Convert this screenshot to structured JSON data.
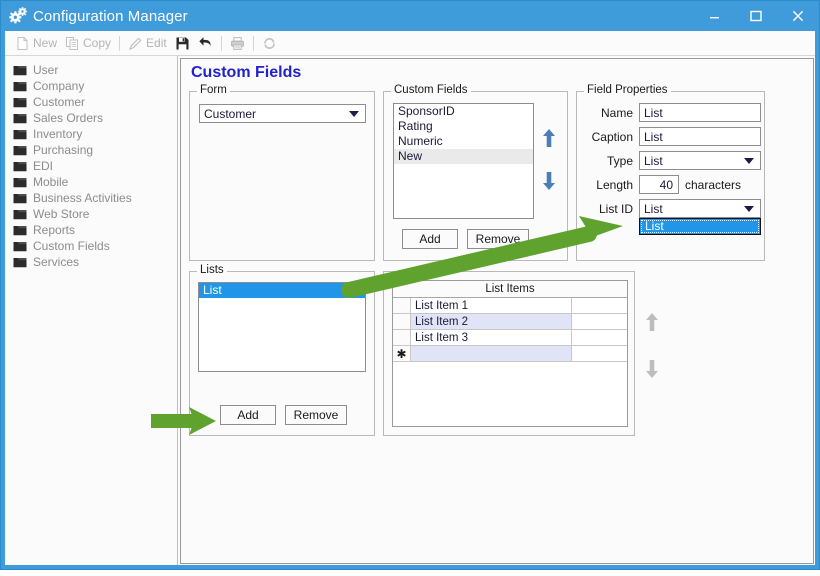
{
  "window": {
    "title": "Configuration Manager",
    "icon": "gears-icon",
    "controls": {
      "minimize": "minimize",
      "maximize": "maximize",
      "close": "close"
    },
    "accent_color": "#3f9bd9"
  },
  "toolbar": {
    "items": [
      {
        "label": "New",
        "icon": "new-document-icon",
        "enabled": false
      },
      {
        "label": "Copy",
        "icon": "copy-icon",
        "enabled": false
      },
      {
        "label": "Edit",
        "icon": "pencil-icon",
        "enabled": false
      },
      {
        "label": "",
        "icon": "save-icon",
        "enabled": true
      },
      {
        "label": "",
        "icon": "undo-icon",
        "enabled": true
      },
      {
        "label": "",
        "icon": "print-icon",
        "enabled": false
      },
      {
        "label": "",
        "icon": "refresh-icon",
        "enabled": false
      }
    ]
  },
  "sidebar": {
    "items": [
      {
        "label": "User"
      },
      {
        "label": "Company"
      },
      {
        "label": "Customer"
      },
      {
        "label": "Sales Orders"
      },
      {
        "label": "Inventory"
      },
      {
        "label": "Purchasing"
      },
      {
        "label": "EDI"
      },
      {
        "label": "Mobile"
      },
      {
        "label": "Business Activities"
      },
      {
        "label": "Web Store"
      },
      {
        "label": "Reports"
      },
      {
        "label": "Custom Fields"
      },
      {
        "label": "Services"
      }
    ]
  },
  "page": {
    "title": "Custom Fields",
    "title_color": "#2222cc"
  },
  "form_group": {
    "legend": "Form",
    "combo_value": "Customer"
  },
  "custom_fields_group": {
    "legend": "Custom Fields",
    "items": [
      {
        "label": "SponsorID",
        "selected": false
      },
      {
        "label": "Rating",
        "selected": false
      },
      {
        "label": "Numeric",
        "selected": false
      },
      {
        "label": "New",
        "selected": true
      }
    ],
    "add_label": "Add",
    "remove_label": "Remove",
    "move_up_icon": "arrow-up-icon",
    "move_down_icon": "arrow-down-icon",
    "arrow_color": "#4a7fb5"
  },
  "field_properties": {
    "legend": "Field Properties",
    "name_label": "Name",
    "name_value": "List",
    "caption_label": "Caption",
    "caption_value": "List",
    "type_label": "Type",
    "type_value": "List",
    "length_label": "Length",
    "length_value": "40",
    "length_suffix": "characters",
    "listid_label": "List ID",
    "listid_value": "List",
    "listid_options": [
      "List"
    ],
    "listid_open": true,
    "highlight_color": "#2196e8"
  },
  "lists_group": {
    "legend": "Lists",
    "items": [
      {
        "label": "List",
        "selected": true
      }
    ],
    "add_label": "Add",
    "remove_label": "Remove"
  },
  "list_items_group": {
    "header": "List Items",
    "new_row_marker": "✱",
    "rows": [
      {
        "value": "List Item 1",
        "selected": false,
        "is_new": false
      },
      {
        "value": "List Item 2",
        "selected": true,
        "is_new": false
      },
      {
        "value": "List Item 3",
        "selected": false,
        "is_new": false
      },
      {
        "value": "",
        "selected": false,
        "is_new": true
      }
    ],
    "move_up_icon": "arrow-up-icon",
    "move_down_icon": "arrow-down-icon",
    "arrow_color": "#bdbdbd"
  },
  "annotations": {
    "color": "#5fa32e",
    "arrows": [
      {
        "name": "arrow-to-listid-dropdown",
        "from": "lists-listbox-item",
        "to": "listid-dropdown-option"
      },
      {
        "name": "arrow-to-lists-add-button",
        "from": "left-margin",
        "to": "lists-add-button"
      }
    ]
  }
}
